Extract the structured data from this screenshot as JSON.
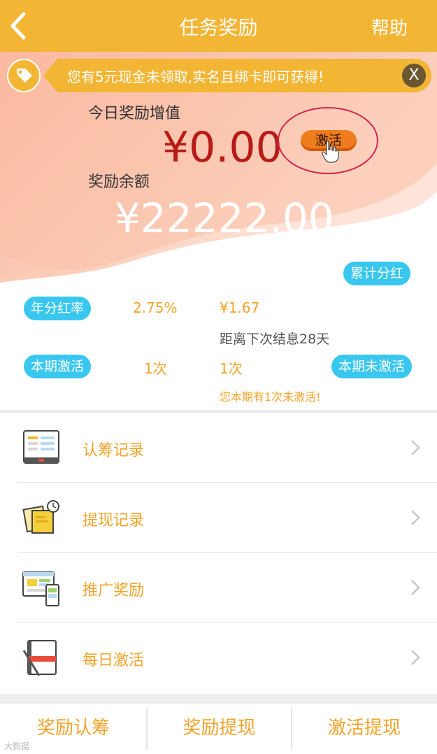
{
  "header": {
    "title": "任务奖励",
    "help_label": "帮助"
  },
  "notice": {
    "text": "您有5元现金未领取,实名且绑卡即可获得!",
    "close_label": "X"
  },
  "reward": {
    "today_label": "今日奖励增值",
    "today_value": "¥0.00",
    "activate_label": "激活",
    "balance_label": "奖励余额",
    "balance_value": "¥22222.00"
  },
  "stats": {
    "cumulative_dividend_label": "累计分红",
    "annual_rate_label": "年分红率",
    "annual_rate_value": "2.75%",
    "cumulative_dividend_value": "¥1.67",
    "next_settlement": "距离下次结息28天",
    "period_activated_label": "本期激活",
    "period_activated_value": "1次",
    "period_not_activated_value": "1次",
    "period_not_activated_label": "本期未激活",
    "warning": "您本期有1次未激活!"
  },
  "menu": {
    "items": [
      {
        "label": "认筹记录",
        "icon": "tablet-icon"
      },
      {
        "label": "提现记录",
        "icon": "note-clock-icon"
      },
      {
        "label": "推广奖励",
        "icon": "devices-icon"
      },
      {
        "label": "每日激活",
        "icon": "notebook-icon"
      }
    ]
  },
  "tabbar": {
    "tabs": [
      "奖励认筹",
      "奖励提现",
      "激活提现"
    ]
  },
  "watermark": "大数据",
  "colors": {
    "brand": "#f3b534",
    "accent_blue": "#39c7ef",
    "value_red": "#b61b16",
    "text_orange": "#f3a32a"
  }
}
